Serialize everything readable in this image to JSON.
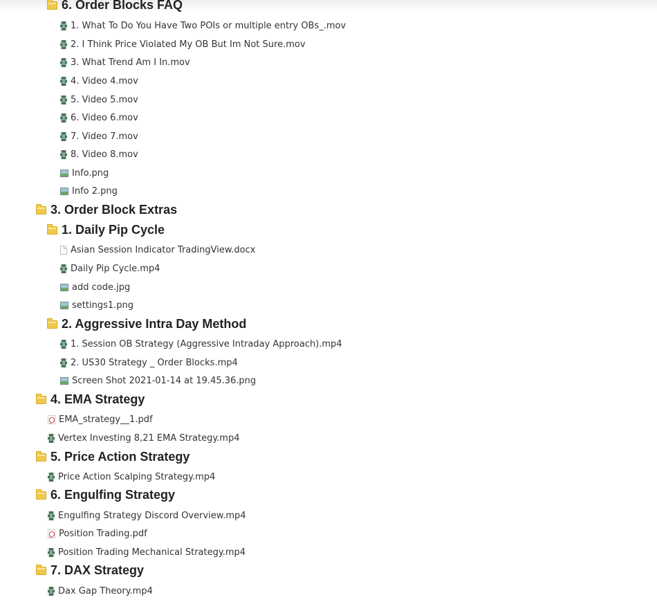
{
  "tree": {
    "folder_6_order_blocks_faq": "6. Order Blocks FAQ",
    "f6_file_1": "1. What To Do You Have Two POIs or multiple entry OBs_.mov",
    "f6_file_2": "2. I Think Price Violated My OB But Im Not Sure.mov",
    "f6_file_3": "3. What Trend Am I In.mov",
    "f6_file_4": "4. Video 4.mov",
    "f6_file_5": "5. Video 5.mov",
    "f6_file_6": "6. Video 6.mov",
    "f6_file_7": "7. Video 7.mov",
    "f6_file_8": "8. Video 8.mov",
    "f6_file_9": "Info.png",
    "f6_file_10": "Info 2.png",
    "folder_3_order_block_extras": "3. Order Block Extras",
    "folder_1_daily_pip_cycle": "1. Daily Pip Cycle",
    "dpc_file_1": "Asian Session Indicator TradingView.docx",
    "dpc_file_2": "Daily Pip Cycle.mp4",
    "dpc_file_3": "add code.jpg",
    "dpc_file_4": "settings1.png",
    "folder_2_aggressive": "2. Aggressive Intra Day Method",
    "agg_file_1": "1. Session OB Strategy (Aggressive Intraday Approach).mp4",
    "agg_file_2": "2. US30 Strategy _ Order Blocks.mp4",
    "agg_file_3": "Screen Shot 2021-01-14 at 19.45.36.png",
    "folder_4_ema": "4. EMA Strategy",
    "ema_file_1": "EMA_strategy__1.pdf",
    "ema_file_2": "Vertex Investing 8,21 EMA Strategy.mp4",
    "folder_5_price_action": "5. Price Action Strategy",
    "pa_file_1": "Price Action Scalping Strategy.mp4",
    "folder_6_engulfing": "6. Engulfing Strategy",
    "eng_file_1": "Engulfing Strategy Discord Overview.mp4",
    "eng_file_2": "Position Trading.pdf",
    "eng_file_3": "Position Trading Mechanical Strategy.mp4",
    "folder_7_dax": "7. DAX Strategy",
    "dax_file_1": "Dax Gap Theory.mp4"
  },
  "icons": {
    "folder": "folder-icon",
    "video": "video-file-icon",
    "image": "image-file-icon",
    "document": "document-file-icon",
    "pdf": "pdf-file-icon"
  },
  "colors": {
    "folder": "#f0c94c",
    "pdf_accent": "#d8333a",
    "text": "#333333"
  }
}
